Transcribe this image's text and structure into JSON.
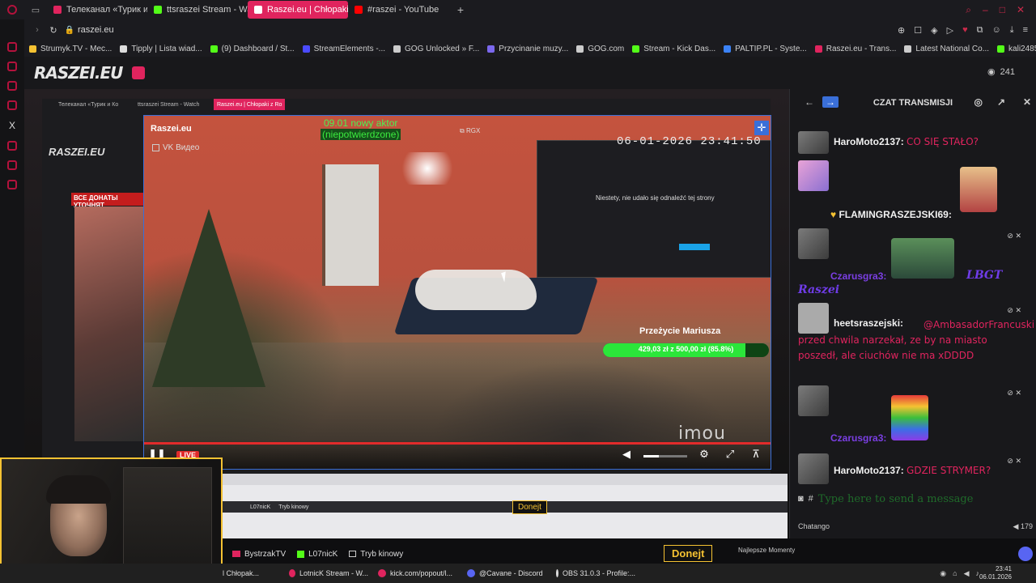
{
  "browser": {
    "tabs": [
      {
        "label": "Телеканал «Турик и Кон",
        "color": "#e0245e",
        "active": false
      },
      {
        "label": "ttsraszei Stream - Watch L",
        "color": "#53fc18",
        "active": false
      },
      {
        "label": "Raszei.eu | Chłopaki z",
        "color": "#e0245e",
        "active": true
      },
      {
        "label": "#raszei - YouTube",
        "color": "#ff0000",
        "active": false
      }
    ],
    "new_tab": "+",
    "url": "raszei.eu",
    "bookmarks": [
      {
        "label": "Strumyk.TV - Mec...",
        "color": "#f5c232"
      },
      {
        "label": "Tipply | Lista wiad...",
        "color": "#ddd"
      },
      {
        "label": "(9) Dashboard / St...",
        "color": "#53fc18"
      },
      {
        "label": "StreamElements -...",
        "color": "#4b4bff"
      },
      {
        "label": "GOG Unlocked » F...",
        "color": "#ccc"
      },
      {
        "label": "Przycinanie muzy...",
        "color": "#7b68ee"
      },
      {
        "label": "GOG.com",
        "color": "#ccc"
      },
      {
        "label": "Stream - Kick Das...",
        "color": "#53fc18"
      },
      {
        "label": "PALTIP.PL - Syste...",
        "color": "#3b82f6"
      },
      {
        "label": "Raszei.eu - Trans...",
        "color": "#e0245e"
      },
      {
        "label": "Latest National Co...",
        "color": "#ccc"
      },
      {
        "label": "kali24853",
        "color": "#53fc18"
      }
    ]
  },
  "site": {
    "logo": "RASZEI.EU",
    "viewers": "241"
  },
  "player": {
    "title": "Raszei.eu",
    "source": "VK Видео",
    "overlay_line1": "09.01 nowy aktor",
    "overlay_line2": "(niepotwierdzone)",
    "rgx": "RGX",
    "datetime": "06-01-2026 23:41:50",
    "browser_overlay_text": "Niestety, nie udało się odnaleźć tej strony",
    "goal_title": "Przeżycie Mariusza",
    "goal_text": "429,03 zł z 500,00 zł (85.8%)",
    "goal_progress": 0.858,
    "watermark": "imou",
    "live": "LIVE",
    "volume_level": 0.36
  },
  "nested": {
    "tab1": "Телеканал «Турик и Ко",
    "tab2": "ttsraszei Stream - Watch",
    "tab3": "Raszei.eu | Chłopaki z Ro",
    "logo": "RASZEI.EU",
    "red_banner": "ВСЕ ДОНАТЫ УТОЧНЯТ",
    "strip_donejt": "Donejt",
    "strip_items": [
      "BystrzakTV",
      "L07nicK",
      "Tryb kinowy"
    ]
  },
  "chat": {
    "header": "CZAT TRANSMISJI",
    "messages": [
      {
        "user": "HaroMoto2137:",
        "text": "CO SIĘ STAŁO?"
      },
      {
        "user": "FLAMINGRASZEJSKI69:",
        "text": ""
      },
      {
        "user": "Czarusgra3:",
        "text": "LBGT"
      },
      {
        "user": "Raszei",
        "text": ""
      },
      {
        "user": "heetsraszejski:",
        "text": "@AmbasadorFrancuski przed chwila narzekał, ze by na miasto poszedł, ale ciuchów nie ma xDDDD"
      },
      {
        "user": "Czarusgra3:",
        "text": ""
      },
      {
        "user": "HaroMoto2137:",
        "text": "GDZIE STRYMER?"
      }
    ],
    "input_placeholder": "Type here to send a message",
    "footer_label": "Chatango",
    "footer_count": "179"
  },
  "bottombar": {
    "items": [
      "BystrzakTV",
      "L07nicK",
      "Tryb kinowy"
    ],
    "donejt": "Donejt",
    "najlepsze": "Najlepsze Momenty"
  },
  "taskbar": {
    "items": [
      {
        "label": "l Chłopak...",
        "color": "#e0245e"
      },
      {
        "label": "LotnicK Stream - W...",
        "color": "#e0245e"
      },
      {
        "label": "kick.com/popout/l...",
        "color": "#e0245e"
      },
      {
        "label": "@Cavane - Discord",
        "color": "#5865f2"
      },
      {
        "label": "OBS 31.0.3 - Profile:...",
        "color": "#ddd"
      }
    ],
    "time": "23:41",
    "date": "06.01.2026"
  }
}
